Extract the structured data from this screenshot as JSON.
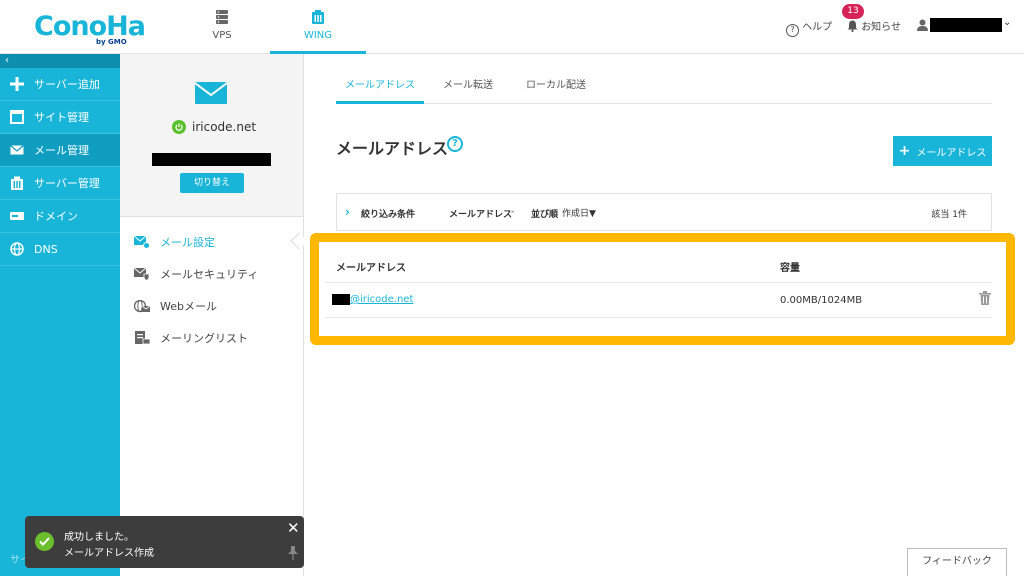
{
  "header": {
    "logo_text": "ConoHa",
    "logo_sub": "by GMO",
    "services": [
      {
        "label": "VPS",
        "icon": "server-icon",
        "active": false
      },
      {
        "label": "WING",
        "icon": "wing-icon",
        "active": true
      }
    ],
    "help_label": "ヘルプ",
    "notice_label": "お知らせ",
    "notice_count": "13"
  },
  "leftnav": {
    "collapse": "‹",
    "items": [
      {
        "label": "サーバー追加",
        "icon": "plus-icon"
      },
      {
        "label": "サイト管理",
        "icon": "window-icon"
      },
      {
        "label": "メール管理",
        "icon": "mail-icon"
      },
      {
        "label": "サーバー管理",
        "icon": "server-manage-icon"
      },
      {
        "label": "ドメイン",
        "icon": "domain-icon"
      },
      {
        "label": "DNS",
        "icon": "globe-icon"
      }
    ],
    "sitemap": "サイトマップ"
  },
  "midpanel": {
    "domain": "iricode.net",
    "switch_label": "切り替え",
    "submenu": [
      {
        "label": "メール設定",
        "icon": "mail-settings-icon"
      },
      {
        "label": "メールセキュリティ",
        "icon": "mail-security-icon"
      },
      {
        "label": "Webメール",
        "icon": "webmail-icon"
      },
      {
        "label": "メーリングリスト",
        "icon": "mailing-list-icon"
      }
    ]
  },
  "main": {
    "tabs": [
      "メールアドレス",
      "メール転送",
      "ローカル配送"
    ],
    "title": "メールアドレス",
    "help_mark": "?",
    "add_button": "メールアドレス",
    "filter": {
      "label": "絞り込み条件",
      "field_label": "メールアドレス",
      "field_value": "-",
      "sort_label": "並び順",
      "sort_value": "作成日▼",
      "count": "該当 1件"
    },
    "table": {
      "col_address": "メールアドレス",
      "col_capacity": "容量",
      "rows": [
        {
          "address": "@iricode.net",
          "capacity": "0.00MB/1024MB"
        }
      ]
    }
  },
  "toast": {
    "line1": "成功しました。",
    "line2": "メールアドレス作成"
  },
  "feedback": "フィードバック",
  "colors": {
    "accent": "#19b5d8",
    "highlight": "#ffb700",
    "badge": "#d6245a",
    "success": "#6cbf2c"
  }
}
